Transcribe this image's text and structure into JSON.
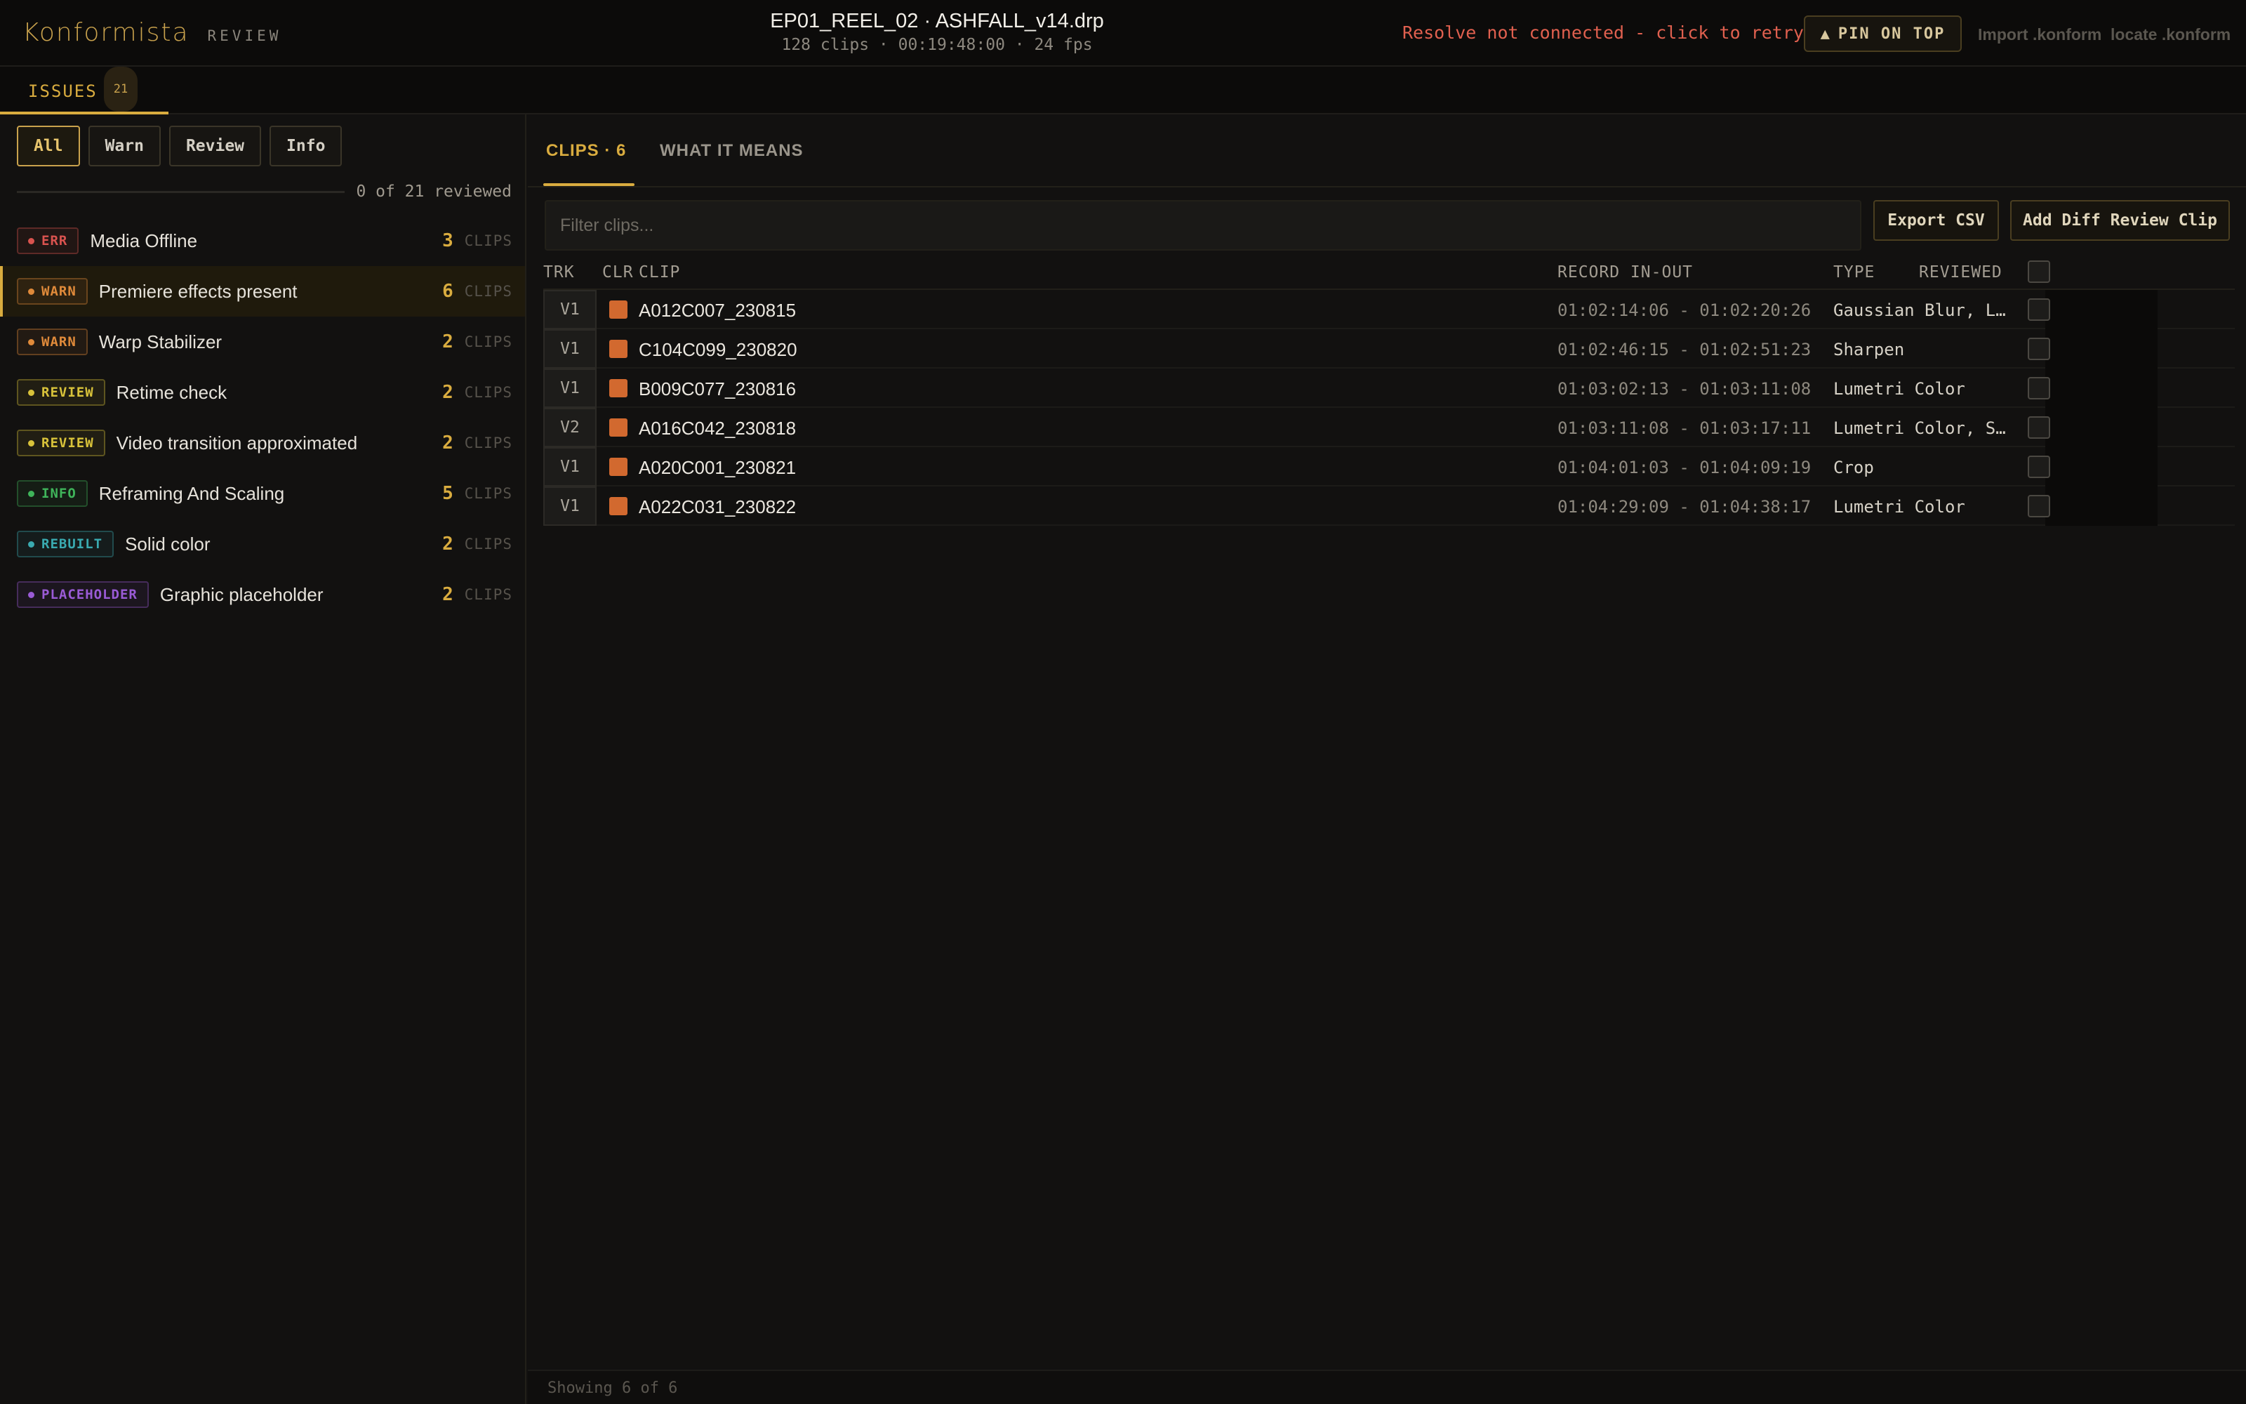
{
  "header": {
    "brand": "Konformista",
    "brand_sub": "REVIEW",
    "title": "EP01_REEL_02 · ASHFALL_v14.drp",
    "subtitle": "128 clips · 00:19:48:00 · 24 fps",
    "resolve_status": "Resolve not connected - click to retry",
    "pin_label": "PIN ON TOP",
    "pin_icon": "triangle-up",
    "import_link": "Import .konform",
    "locate_link": "locate .konform"
  },
  "tabstrip": {
    "issues_label": "ISSUES",
    "issues_count": "21"
  },
  "sidebar": {
    "filters": [
      "All",
      "Warn",
      "Review",
      "Info"
    ],
    "active_filter": "All",
    "progress": {
      "text": "0 of 21 reviewed",
      "reviewed": 0,
      "total": 21
    },
    "clips_unit": "CLIPS",
    "issues": [
      {
        "severity": "ERR",
        "name": "Media Offline",
        "count": "3",
        "color": "#d9534f"
      },
      {
        "severity": "WARN",
        "name": "Premiere effects present",
        "count": "6",
        "color": "#e08a3a",
        "selected": true
      },
      {
        "severity": "WARN",
        "name": "Warp Stabilizer",
        "count": "2",
        "color": "#e08a3a"
      },
      {
        "severity": "REVIEW",
        "name": "Retime check",
        "count": "2",
        "color": "#d8c23a"
      },
      {
        "severity": "REVIEW",
        "name": "Video transition approximated",
        "count": "2",
        "color": "#d8c23a"
      },
      {
        "severity": "INFO",
        "name": "Reframing And Scaling",
        "count": "5",
        "color": "#3fb45a"
      },
      {
        "severity": "REBUILT",
        "name": "Solid color",
        "count": "2",
        "color": "#3aaab0"
      },
      {
        "severity": "PLACEHOLDER",
        "name": "Graphic placeholder",
        "count": "2",
        "color": "#9a5bd6"
      }
    ]
  },
  "main": {
    "tab_clips": "CLIPS · 6",
    "tab_means": "WHAT IT MEANS",
    "filter_placeholder": "Filter clips...",
    "export_label": "Export CSV",
    "add_label": "Add Diff Review Clip",
    "columns": {
      "trk": "TRK",
      "clr": "CLR",
      "clip": "CLIP",
      "record": "RECORD IN-OUT",
      "type": "TYPE",
      "reviewed": "REVIEWED"
    },
    "clip_color": "#d2692f",
    "rows": [
      {
        "trk": "V1",
        "clip": "A012C007_230815",
        "record": "01:02:14:06 - 01:02:20:26",
        "type": "Gaussian Blur, Lumetri Color"
      },
      {
        "trk": "V1",
        "clip": "C104C099_230820",
        "record": "01:02:46:15 - 01:02:51:23",
        "type": "Sharpen"
      },
      {
        "trk": "V1",
        "clip": "B009C077_230816",
        "record": "01:03:02:13 - 01:03:11:08",
        "type": "Lumetri Color"
      },
      {
        "trk": "V2",
        "clip": "A016C042_230818",
        "record": "01:03:11:08 - 01:03:17:11",
        "type": "Lumetri Color, Sharpen"
      },
      {
        "trk": "V1",
        "clip": "A020C001_230821",
        "record": "01:04:01:03 - 01:04:09:19",
        "type": "Crop"
      },
      {
        "trk": "V1",
        "clip": "A022C031_230822",
        "record": "01:04:29:09 - 01:04:38:17",
        "type": "Lumetri Color"
      }
    ],
    "footer": "Showing 6 of 6"
  }
}
